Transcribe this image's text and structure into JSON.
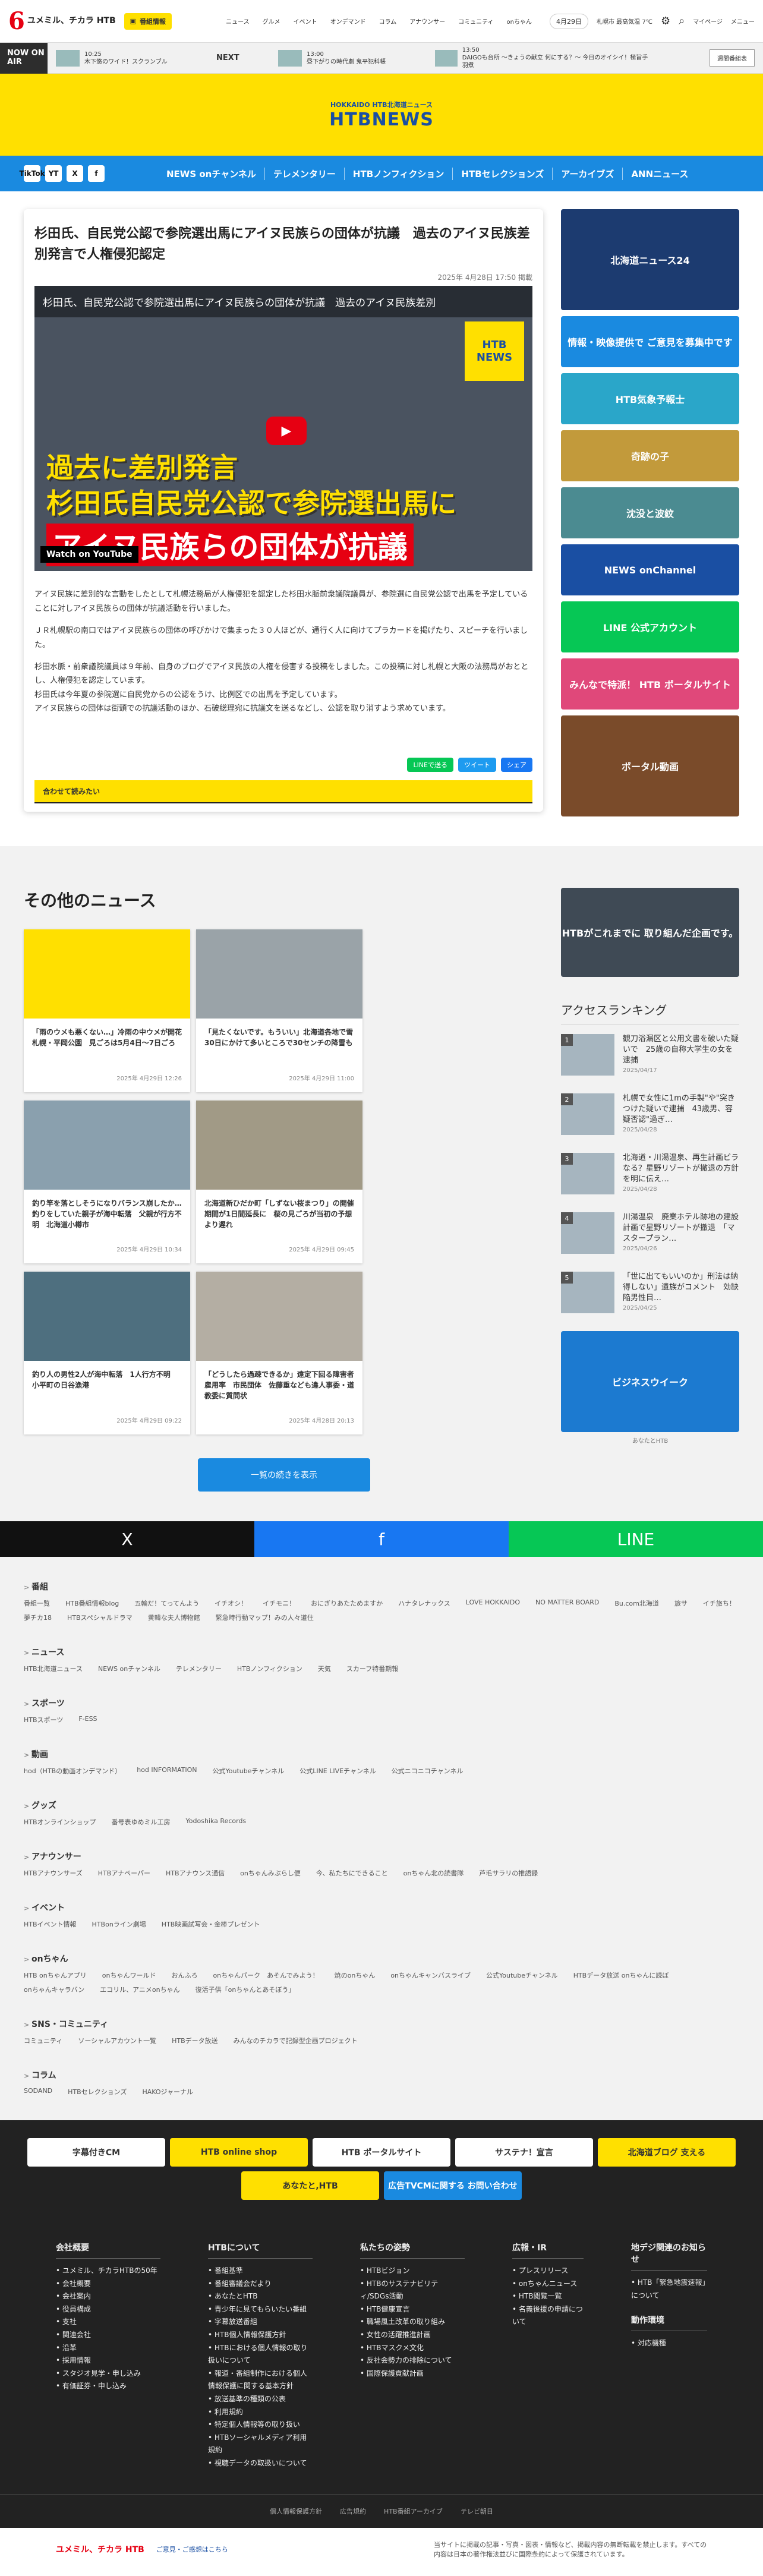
{
  "header": {
    "logo_num": "6",
    "logo_text": "ユメミル、チカラ HTB",
    "badge": "番組情報",
    "nav": [
      "ニュース",
      "グルメ",
      "イベント",
      "オンデマンド",
      "コラム",
      "アナウンサー",
      "コミュニティ",
      "onちゃん"
    ],
    "date": "4月29日",
    "weather": "札幌市 最高気温 7℃",
    "mypage": "マイページ",
    "menu": "メニュー",
    "icons": [
      "gear-icon",
      "search-icon"
    ]
  },
  "onair": {
    "label": "NOW ON AIR",
    "progs": [
      {
        "time": "10:25",
        "title": "木下悠のワイド！スクランブル"
      }
    ],
    "next": "NEXT",
    "next_progs": [
      {
        "time": "13:00",
        "title": "昼下がりの時代劇 鬼平犯科帳"
      },
      {
        "time": "13:50",
        "title": "DAIGOも台所 ～きょうの献立 何にする？～ 今日のオイシイ！極旨手羽煮"
      }
    ],
    "weekly": "週間番組表"
  },
  "hero": {
    "small": "HOKKAIDO HTB北海道ニュース",
    "big": "HTBNEWS"
  },
  "gnav": [
    "NEWS onチャンネル",
    "テレメンタリー",
    "HTBノンフィクション",
    "HTBセレクションズ",
    "アーカイブズ",
    "ANNニュース"
  ],
  "sns": [
    "TikTok",
    "YT",
    "X",
    "f"
  ],
  "article": {
    "title": "杉田氏、自民党公認で参院選出馬にアイヌ民族らの団体が抗議　過去のアイヌ民族差別発言で人権侵犯認定",
    "date": "2025年 4月28日 17:50 掲載",
    "video": {
      "top": "杉田氏、自民党公認で参院選出馬にアイヌ民族らの団体が抗議　過去のアイヌ民族差別",
      "cap1": "過去に差別発言",
      "cap2": "杉田氏自民党公認で参院選出馬に",
      "cap3": "アイヌ民族らの団体が抗議",
      "watch": "Watch on YouTube",
      "logo": "HTB NEWS"
    },
    "paras": [
      "アイヌ民族に差別的な言動をしたとして札幌法務局が人権侵犯を認定した杉田水脈前衆議院議員が、参院選に自民党公認で出馬を予定していることに対しアイヌ民族らの団体が抗議活動を行いました。",
      "ＪＲ札幌駅の南口ではアイヌ民族らの団体の呼びかけで集まった３０人ほどが、通行く人に向けてプラカードを掲げたり、スピーチを行いました。",
      "杉田水脈・前衆議院議員は９年前、自身のブログでアイヌ民族の人権を侵害する投稿をしました。この投稿に対し札幌と大阪の法務局がおととし、人権侵犯を認定しています。",
      "杉田氏は今年夏の参院選に自民党からの公認をうけ、比例区での出馬を予定しています。",
      "アイヌ民族らの団体は街頭での抗議活動のほか、石破総理宛に抗議文を送るなどし、公認を取り消すよう求めています。"
    ],
    "share": [
      "LINEで送る",
      "ツイート",
      "シェア"
    ],
    "together": "合わせて読みたい"
  },
  "side_banners": [
    {
      "label": "北海道ニュース24",
      "color": "#1c3b70"
    },
    {
      "label": "情報・映像提供で ご意見を募集中です",
      "color": "#1a8ae0"
    },
    {
      "label": "HTB気象予報士",
      "color": "#2aa6c9"
    },
    {
      "label": "奇跡の子",
      "color": "#c29a3b"
    },
    {
      "label": "沈没と波紋",
      "color": "#4b8b91"
    },
    {
      "label": "NEWS onChannel",
      "color": "#1a4fa3"
    },
    {
      "label": "LINE 公式アカウント",
      "color": "#06c755"
    },
    {
      "label": "みんなで特派！ HTB ポータルサイト",
      "color": "#e0487a"
    },
    {
      "label": "ポータル動画",
      "color": "#7a4b2a"
    }
  ],
  "other": {
    "title": "その他のニュース",
    "cards": [
      {
        "title": "「雨のウメも悪くない…」冷雨の中ウメが開花　札幌・平岡公園　見ごろは5月4日～7日ごろ",
        "date": "2025年 4月29日 12:26"
      },
      {
        "title": "「見たくないです。もういい」北海道各地で雪　30日にかけて多いところで30センチの降雪も",
        "date": "2025年 4月29日 11:00"
      },
      {
        "title": "釣り竿を落としそうになりバランス崩したか…釣りをしていた親子が海中転落　父親が行方不明　北海道小樽市",
        "date": "2025年 4月29日 10:34"
      },
      {
        "title": "北海道新ひだか町「しずない桜まつり」の開催期間が1日間延長に　桜の見ごろが当初の予想より遅れ",
        "date": "2025年 4月29日 09:45"
      },
      {
        "title": "釣り人の男性2人が海中転落　1人行方不明　小平町の日谷漁港",
        "date": "2025年 4月29日 09:22"
      },
      {
        "title": "「どうしたら過疎できるか」遠定下回る障害者雇用率　市民団体　佐藤重なども違人事委・道教委に質問状",
        "date": "2025年 4月28日 20:13"
      }
    ],
    "more": "一覧の続きを表示"
  },
  "side2": {
    "banner": "HTBがこれまでに 取り組んだ企画です。",
    "rank_title": "アクセスランキング",
    "ranks": [
      {
        "n": "1",
        "title": "観刀浴漏区と公用文書を破いた疑いで　25歳の自称大学生の女を逮捕",
        "date": "2025/04/17"
      },
      {
        "n": "2",
        "title": "札幌で女性に1mの手製\"や\"突きつけた疑いで逮捕　43歳男、容疑否認\"過ぎ…",
        "date": "2025/04/28"
      },
      {
        "n": "3",
        "title": "北海道・川湯温泉、再生計画ピラなる？星野リゾートが撤退の方針を明に伝え…",
        "date": "2025/04/28"
      },
      {
        "n": "4",
        "title": "川湯温泉　廃業ホテル跡地の建設計画で星野リゾートが撤退　「マスタープラン…",
        "date": "2025/04/26"
      },
      {
        "n": "5",
        "title": "「世に出てもいいのか」刑法は納得しない」遺族がコメント　効缺陥男性目…",
        "date": "2025/04/25"
      }
    ],
    "video_banner": "ビジネスウイーク",
    "video_caption": "あなたとHTB"
  },
  "snsbar": [
    {
      "icon": "X",
      "color": "#111"
    },
    {
      "icon": "f",
      "color": "#1877f2"
    },
    {
      "icon": "LINE",
      "color": "#06c755"
    }
  ],
  "sitemap": [
    {
      "h": "番組",
      "links": [
        "番組一覧",
        "HTB番組情報blog",
        "五輪だ！てってんよう",
        "イチオシ！",
        "イチモニ！",
        "おにぎりあたためますか",
        "ハナタレナックス",
        "LOVE HOKKAIDO",
        "NO MATTER BOARD",
        "Bu.com北海道",
        "旅サ",
        "イチ旅ち！",
        "夢チカ18",
        "HTBスペシャルドラマ",
        "黄韓な夫人博物館",
        "緊急時行動マップ！みの人々道住"
      ]
    },
    {
      "h": "ニュース",
      "links": [
        "HTB北海道ニュース",
        "NEWS onチャンネル",
        "テレメンタリー",
        "HTBノンフィクション",
        "天気",
        "スカーフ特番期報"
      ]
    },
    {
      "h": "スポーツ",
      "links": [
        "HTBスポーツ",
        "F-ESS"
      ]
    },
    {
      "h": "動画",
      "links": [
        "hod（HTBの動画オンデマンド）",
        "hod INFORMATION",
        "公式Youtubeチャンネル",
        "公式LINE LIVEチャンネル",
        "公式ニコニコチャンネル"
      ]
    },
    {
      "h": "グッズ",
      "links": [
        "HTBオンラインショップ",
        "番号表ゆめミル工房",
        "Yodoshika Records"
      ]
    },
    {
      "h": "アナウンサー",
      "links": [
        "HTBアナウンサーズ",
        "HTBアナペーパー",
        "HTBアナウンス通信",
        "onちゃんみぶらし便",
        "今、私たちにできること",
        "onちゃん北の読書隊",
        "芦毛サラリの推語録"
      ]
    },
    {
      "h": "イベント",
      "links": [
        "HTBイベント情報",
        "HTBonライン劇場",
        "HTB映画試写会・金棒プレゼント"
      ]
    },
    {
      "h": "onちゃん",
      "links": [
        "HTB onちゃんアプリ",
        "onちゃんワールド",
        "おんふろ",
        "onちゃんパーク　あそんでみよう！",
        "焼のonちゃん",
        "onちゃんキャンバスライブ",
        "公式Youtubeチャンネル",
        "HTBデータ放送 onちゃんに読ぼ",
        "onちゃんキャラバン",
        "エコリル、アニメonちゃん",
        "復活子供「onちゃんとあそぼう」"
      ]
    },
    {
      "h": "SNS・コミュニティ",
      "links": [
        "コミュニティ",
        "ソーシャルアカウント一覧",
        "HTBデータ放送",
        "みんなのチカラで記録型企画プロジェクト"
      ]
    },
    {
      "h": "コラム",
      "links": [
        "SODAND",
        "HTBセレクションズ",
        "HAKOジャーナル"
      ]
    }
  ],
  "ads": [
    {
      "label": "字幕付きCM",
      "color": "#fff"
    },
    {
      "label": "HTB online shop",
      "color": "#ffe000"
    },
    {
      "label": "HTB ポータルサイト",
      "color": "#fff"
    },
    {
      "label": "サステナ！宣言",
      "color": "#fff"
    },
    {
      "label": "北海道ブログ 支える",
      "color": "#ffe000"
    },
    {
      "label": "あなたと,HTB",
      "color": "#ffe000"
    },
    {
      "label": "広告TVCMに関する お問い合わせ",
      "color": "#1a8ae0"
    }
  ],
  "footer": [
    {
      "h": "会社概要",
      "links": [
        "ユメミル、チカラHTBの50年",
        "会社概要",
        "会社案内",
        "役員構成",
        "支社",
        "関連会社",
        "沿革",
        "採用情報",
        "スタジオ見学・申し込み",
        "有価証券・申し込み"
      ]
    },
    {
      "h": "HTBについて",
      "links": [
        "番組基準",
        "番組審議会だより",
        "あなたとHTB",
        "青少年に見てもらいたい番組",
        "字幕放送番組",
        "HTB個人情報保護方針",
        "HTBにおける個人情報の取り扱いについて",
        "報道・番組制作における個人情報保護に関する基本方針",
        "放送基準の種類の公表",
        "利用規約",
        "特定個人情報等の取り扱い",
        "HTBソーシャルメディア利用規約",
        "視聴データの取扱いについて"
      ]
    },
    {
      "h": "私たちの姿勢",
      "links": [
        "HTBビジョン",
        "HTBのサステナビリティ/SDGs活動",
        "HTB健康宣言",
        "職場風土改革の取り組み",
        "女性の活躍推進計画",
        "HTBマスクメ文化",
        "反社会勢力の排除について",
        "国際保護貢献計画"
      ]
    },
    {
      "h": "広報・IR",
      "links": [
        "プレスリリース",
        "onちゃんニュース",
        "HTB閲覧一覧",
        "名義後援の申請について"
      ]
    },
    {
      "h": "地デジ関連のお知らせ",
      "links": [
        "HTB「緊急地震速報」について"
      ],
      "h2": "動作環境",
      "links2": [
        "対応機種"
      ]
    }
  ],
  "footer_bottom": [
    "個人情報保護方針",
    "広告規約",
    "HTB番組アーカイブ",
    "テレビ朝日"
  ],
  "copyright": {
    "logo": "ユメミル、チカラ HTB",
    "link": "ご意見・ご感想はこちら",
    "text": "当サイトに掲載の記事・写真・図表・情報など、掲載内容の無断転載を禁止します。すべての内容は日本の著作権法並びに国際条約によって保護されています。"
  }
}
